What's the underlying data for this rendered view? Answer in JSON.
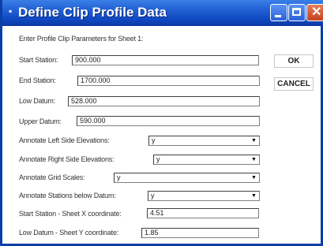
{
  "window": {
    "title": "Define Clip Profile Data",
    "title_icon": "dialog-icon",
    "controls": {
      "close_glyph": "✕"
    }
  },
  "form": {
    "intro": "Enter Profile Clip Parameters for Sheet 1:",
    "start_station": {
      "label": "Start Station:",
      "value": "900.000"
    },
    "end_station": {
      "label": "End Station:",
      "value": "1700.000"
    },
    "low_datum": {
      "label": "Low Datum:",
      "value": "528.000"
    },
    "upper_datum": {
      "label": "Upper Datum:",
      "value": "590.000"
    },
    "annotate_left": {
      "label": "Annotate Left Side Elevations:",
      "value": "y"
    },
    "annotate_right": {
      "label": "Annotate Right Side Elevations:",
      "value": "y"
    },
    "annotate_grid": {
      "label": "Annotate Grid Scales:",
      "value": "y"
    },
    "annotate_stations": {
      "label": "Annotate Stations below Datum:",
      "value": "y"
    },
    "start_station_x": {
      "label": "Start Station - Sheet X coordinate:",
      "value": "4.51"
    },
    "low_datum_y": {
      "label": "Low Datum - Sheet Y coordinate:",
      "value": "1.85"
    },
    "dropdown_glyph": "▼"
  },
  "buttons": {
    "ok": "OK",
    "cancel": "CANCEL"
  }
}
